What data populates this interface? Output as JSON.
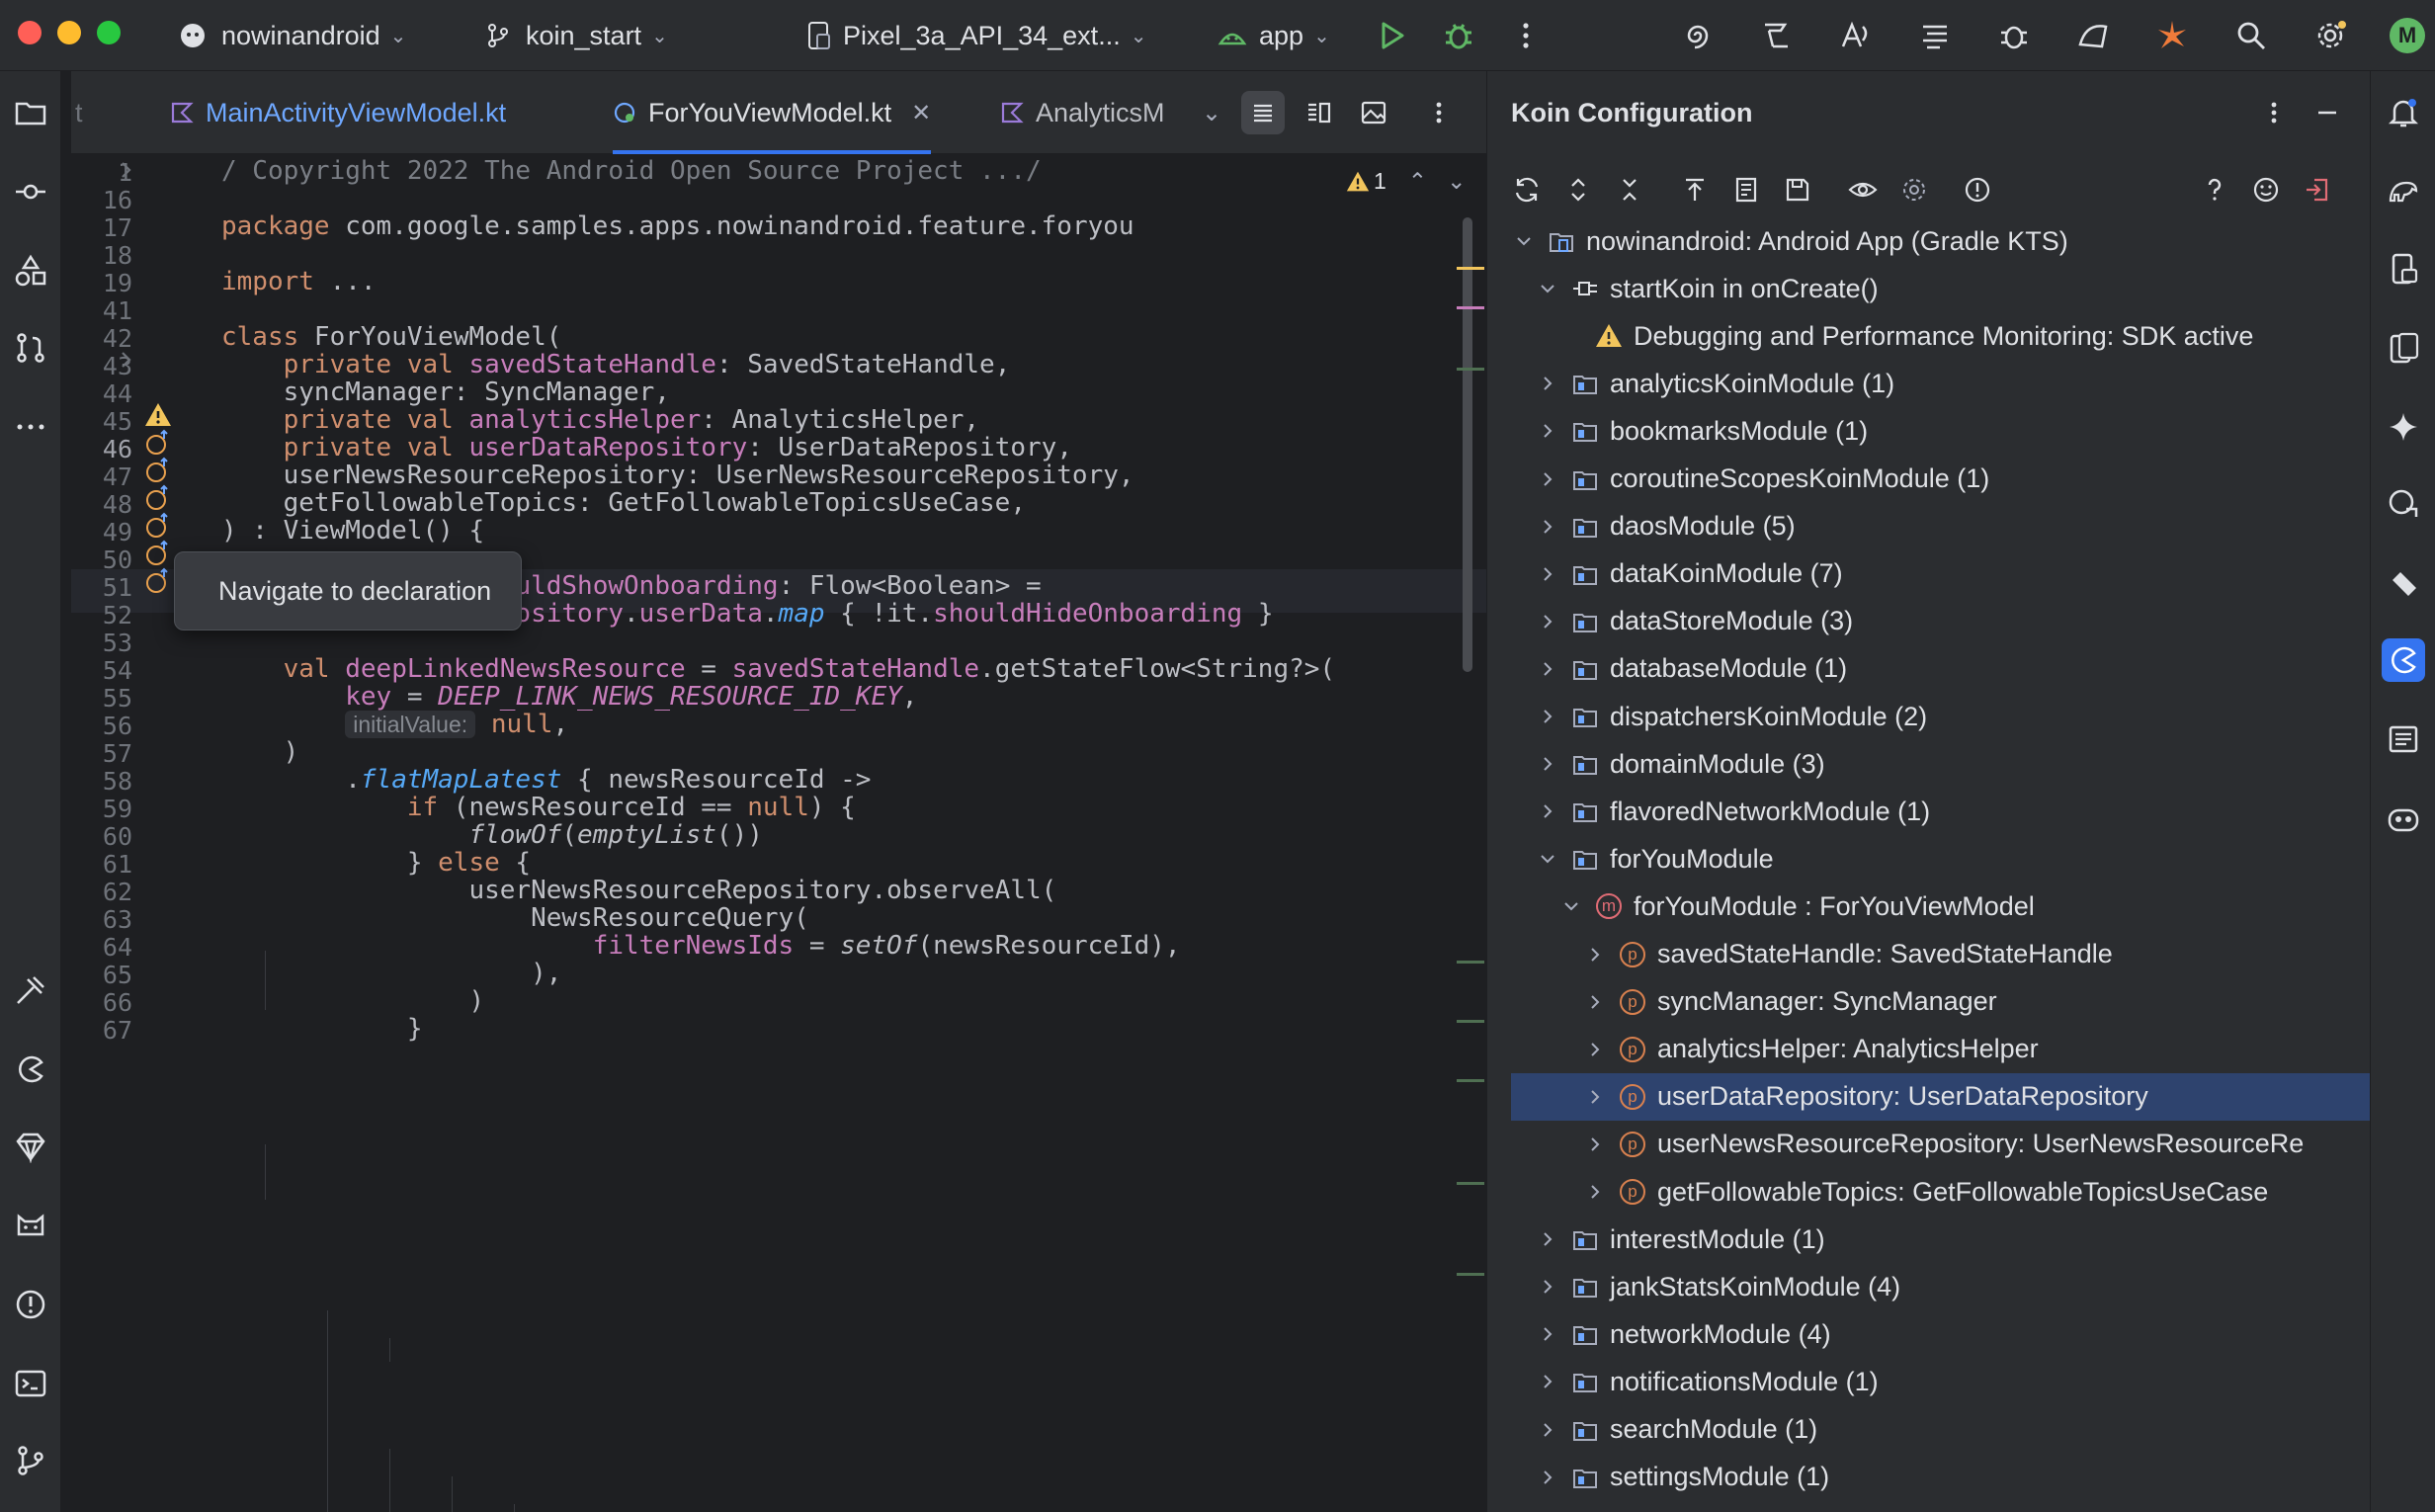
{
  "colors": {
    "accent": "#3574f0",
    "keyword": "#cf8e6d",
    "property": "#c77dbb",
    "function": "#56a8f5",
    "warning": "#f2c55c",
    "selection": "#2e436e"
  },
  "titlebar": {
    "project": "nowinandroid",
    "branch": "koin_start",
    "device": "Pixel_3a_API_34_ext...",
    "run_config": "app",
    "avatar_letter": "M"
  },
  "tabs": {
    "hidden_left": "t",
    "tab1": "MainActivityViewModel.kt",
    "tab2": "ForYouViewModel.kt",
    "tab3": "AnalyticsM"
  },
  "editor": {
    "warning_count": "1",
    "lines": [
      {
        "n": "1",
        "text": "/ Copyright 2022 The Android Open Source Project .../"
      },
      {
        "n": "16",
        "text": ""
      },
      {
        "n": "17",
        "text": "package com.google.samples.apps.nowinandroid.feature.foryou"
      },
      {
        "n": "18",
        "text": ""
      },
      {
        "n": "19",
        "text": "import ..."
      },
      {
        "n": "41",
        "text": ""
      },
      {
        "n": "42",
        "text": "class ForYouViewModel("
      },
      {
        "n": "43",
        "text": "    private val savedStateHandle: SavedStateHandle,"
      },
      {
        "n": "44",
        "text": "    syncManager: SyncManager,"
      },
      {
        "n": "45",
        "text": "    private val analyticsHelper: AnalyticsHelper,"
      },
      {
        "n": "46",
        "text": "    private val userDataRepository: UserDataRepository,"
      },
      {
        "n": "47",
        "text": "    userNewsResourceRepository: UserNewsResourceRepository,"
      },
      {
        "n": "48",
        "text": "    getFollowableTopics: GetFollowableTopicsUseCase,"
      },
      {
        "n": "49",
        "text": ") : ViewModel() {"
      },
      {
        "n": "50",
        "text": ""
      },
      {
        "n": "51",
        "text": "    private val shouldShowOnboarding: Flow<Boolean> ="
      },
      {
        "n": "52",
        "text": "        userDataRepository.userData.map { !it.shouldHideOnboarding }"
      },
      {
        "n": "53",
        "text": ""
      },
      {
        "n": "54",
        "text": "    val deepLinkedNewsResource = savedStateHandle.getStateFlow<String?>("
      },
      {
        "n": "55",
        "text": "        key = DEEP_LINK_NEWS_RESOURCE_ID_KEY,"
      },
      {
        "n": "56",
        "text": "        initialValue: null,"
      },
      {
        "n": "57",
        "text": "    )"
      },
      {
        "n": "58",
        "text": "        .flatMapLatest { newsResourceId ->"
      },
      {
        "n": "59",
        "text": "            if (newsResourceId == null) {"
      },
      {
        "n": "60",
        "text": "                flowOf(emptyList())"
      },
      {
        "n": "61",
        "text": "            } else {"
      },
      {
        "n": "62",
        "text": "                userNewsResourceRepository.observeAll("
      },
      {
        "n": "63",
        "text": "                    NewsResourceQuery("
      },
      {
        "n": "64",
        "text": "                        filterNewsIds = setOf(newsResourceId),"
      },
      {
        "n": "65",
        "text": "                    ),"
      },
      {
        "n": "66",
        "text": "                )"
      },
      {
        "n": "67",
        "text": "            }"
      }
    ],
    "tooltip": "Navigate to declaration",
    "inlay_hint": "initialValue:"
  },
  "koin": {
    "title": "Koin Configuration",
    "tree": [
      {
        "label": "nowinandroid: Android App (Gradle KTS)",
        "level": 0,
        "expanded": true,
        "icon": "project-icon"
      },
      {
        "label": "startKoin in onCreate()",
        "level": 1,
        "expanded": true,
        "icon": "plug-icon"
      },
      {
        "label": "Debugging and Performance Monitoring: SDK active",
        "level": 2,
        "icon": "warning-icon"
      },
      {
        "label": "analyticsKoinModule (1)",
        "level": 1,
        "icon": "folder-icon"
      },
      {
        "label": "bookmarksModule (1)",
        "level": 1,
        "icon": "folder-icon"
      },
      {
        "label": "coroutineScopesKoinModule (1)",
        "level": 1,
        "icon": "folder-icon"
      },
      {
        "label": "daosModule (5)",
        "level": 1,
        "icon": "folder-icon"
      },
      {
        "label": "dataKoinModule (7)",
        "level": 1,
        "icon": "folder-icon"
      },
      {
        "label": "dataStoreModule (3)",
        "level": 1,
        "icon": "folder-icon"
      },
      {
        "label": "databaseModule (1)",
        "level": 1,
        "icon": "folder-icon"
      },
      {
        "label": "dispatchersKoinModule (2)",
        "level": 1,
        "icon": "folder-icon"
      },
      {
        "label": "domainModule (3)",
        "level": 1,
        "icon": "folder-icon"
      },
      {
        "label": "flavoredNetworkModule (1)",
        "level": 1,
        "icon": "folder-icon"
      },
      {
        "label": "forYouModule",
        "level": 1,
        "expanded": true,
        "icon": "folder-icon"
      },
      {
        "label": "forYouModule : ForYouViewModel",
        "level": 2,
        "expanded": true,
        "icon": "m-badge-icon"
      },
      {
        "label": "savedStateHandle: SavedStateHandle",
        "level": 3,
        "icon": "p-badge-icon"
      },
      {
        "label": "syncManager: SyncManager",
        "level": 3,
        "icon": "p-badge-icon"
      },
      {
        "label": "analyticsHelper: AnalyticsHelper",
        "level": 3,
        "icon": "p-badge-icon"
      },
      {
        "label": "userDataRepository: UserDataRepository",
        "level": 3,
        "icon": "p-badge-icon",
        "selected": true
      },
      {
        "label": "userNewsResourceRepository: UserNewsResourceRe",
        "level": 3,
        "icon": "p-badge-icon"
      },
      {
        "label": "getFollowableTopics: GetFollowableTopicsUseCase",
        "level": 3,
        "icon": "p-badge-icon"
      },
      {
        "label": "interestModule (1)",
        "level": 1,
        "icon": "folder-icon"
      },
      {
        "label": "jankStatsKoinModule (4)",
        "level": 1,
        "icon": "folder-icon"
      },
      {
        "label": "networkModule (4)",
        "level": 1,
        "icon": "folder-icon"
      },
      {
        "label": "notificationsModule (1)",
        "level": 1,
        "icon": "folder-icon"
      },
      {
        "label": "searchModule (1)",
        "level": 1,
        "icon": "folder-icon"
      },
      {
        "label": "settingsModule (1)",
        "level": 1,
        "icon": "folder-icon"
      }
    ]
  }
}
